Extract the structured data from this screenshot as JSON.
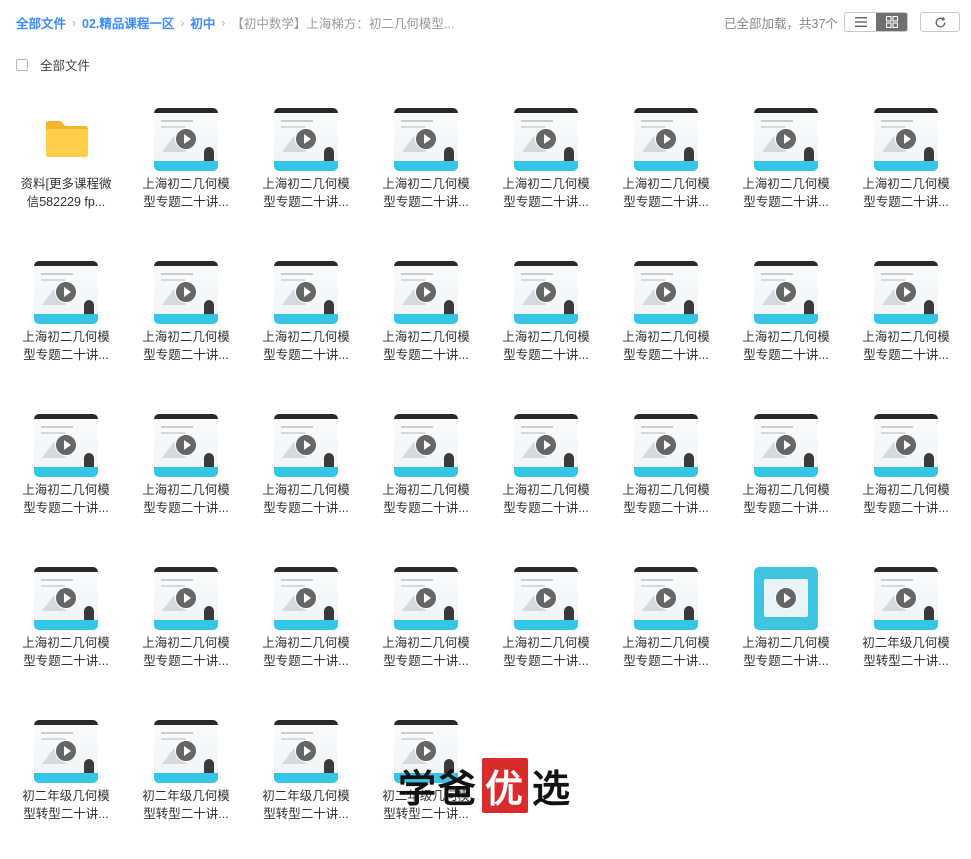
{
  "breadcrumb": {
    "items": [
      "全部文件",
      "02.精品课程一区",
      "初中"
    ],
    "current": "【初中数学】上海梯方：初二几何模型..."
  },
  "header": {
    "status": "已全部加载，共37个"
  },
  "toolbar": {
    "list_view_icon": "list-icon",
    "grid_view_icon": "grid-icon",
    "refresh_icon": "refresh-icon",
    "active_view": "grid"
  },
  "select_all": {
    "label": "全部文件",
    "checked": false
  },
  "files": [
    {
      "type": "folder",
      "name_line1": "资料[更多课程微",
      "name_line2": "信582229 fp..."
    },
    {
      "type": "video",
      "name_line1": "上海初二几何模",
      "name_line2": "型专题二十讲..."
    },
    {
      "type": "video",
      "name_line1": "上海初二几何模",
      "name_line2": "型专题二十讲..."
    },
    {
      "type": "video",
      "name_line1": "上海初二几何模",
      "name_line2": "型专题二十讲..."
    },
    {
      "type": "video",
      "name_line1": "上海初二几何模",
      "name_line2": "型专题二十讲..."
    },
    {
      "type": "video",
      "name_line1": "上海初二几何模",
      "name_line2": "型专题二十讲..."
    },
    {
      "type": "video",
      "name_line1": "上海初二几何模",
      "name_line2": "型专题二十讲..."
    },
    {
      "type": "video",
      "name_line1": "上海初二几何模",
      "name_line2": "型专题二十讲..."
    },
    {
      "type": "video",
      "name_line1": "上海初二几何模",
      "name_line2": "型专题二十讲..."
    },
    {
      "type": "video",
      "name_line1": "上海初二几何模",
      "name_line2": "型专题二十讲..."
    },
    {
      "type": "video",
      "name_line1": "上海初二几何模",
      "name_line2": "型专题二十讲..."
    },
    {
      "type": "video",
      "name_line1": "上海初二几何模",
      "name_line2": "型专题二十讲..."
    },
    {
      "type": "video",
      "name_line1": "上海初二几何模",
      "name_line2": "型专题二十讲..."
    },
    {
      "type": "video",
      "name_line1": "上海初二几何模",
      "name_line2": "型专题二十讲..."
    },
    {
      "type": "video",
      "name_line1": "上海初二几何模",
      "name_line2": "型专题二十讲..."
    },
    {
      "type": "video",
      "name_line1": "上海初二几何模",
      "name_line2": "型专题二十讲..."
    },
    {
      "type": "video",
      "name_line1": "上海初二几何模",
      "name_line2": "型专题二十讲..."
    },
    {
      "type": "video",
      "name_line1": "上海初二几何模",
      "name_line2": "型专题二十讲..."
    },
    {
      "type": "video",
      "name_line1": "上海初二几何模",
      "name_line2": "型专题二十讲..."
    },
    {
      "type": "video",
      "name_line1": "上海初二几何模",
      "name_line2": "型专题二十讲..."
    },
    {
      "type": "video",
      "name_line1": "上海初二几何模",
      "name_line2": "型专题二十讲..."
    },
    {
      "type": "video",
      "name_line1": "上海初二几何模",
      "name_line2": "型专题二十讲..."
    },
    {
      "type": "video",
      "name_line1": "上海初二几何模",
      "name_line2": "型专题二十讲..."
    },
    {
      "type": "video",
      "name_line1": "上海初二几何模",
      "name_line2": "型专题二十讲..."
    },
    {
      "type": "video",
      "name_line1": "上海初二几何模",
      "name_line2": "型专题二十讲..."
    },
    {
      "type": "video",
      "name_line1": "上海初二几何模",
      "name_line2": "型专题二十讲..."
    },
    {
      "type": "video",
      "name_line1": "上海初二几何模",
      "name_line2": "型专题二十讲..."
    },
    {
      "type": "video",
      "name_line1": "上海初二几何模",
      "name_line2": "型专题二十讲..."
    },
    {
      "type": "video",
      "name_line1": "上海初二几何模",
      "name_line2": "型专题二十讲..."
    },
    {
      "type": "video",
      "name_line1": "上海初二几何模",
      "name_line2": "型专题二十讲..."
    },
    {
      "type": "video",
      "name_line1": "上海初二几何模",
      "name_line2": "型专题二十讲...",
      "thumb_style": "teal"
    },
    {
      "type": "video",
      "name_line1": "初二年级几何模",
      "name_line2": "型转型二十讲..."
    },
    {
      "type": "video",
      "name_line1": "初二年级几何模",
      "name_line2": "型转型二十讲..."
    },
    {
      "type": "video",
      "name_line1": "初二年级几何模",
      "name_line2": "型转型二十讲..."
    },
    {
      "type": "video",
      "name_line1": "初二年级几何模",
      "name_line2": "型转型二十讲..."
    },
    {
      "type": "video",
      "name_line1": "初二年级几何模",
      "name_line2": "型转型二十讲..."
    }
  ],
  "watermark": {
    "text_before": "学爸",
    "text_red": "优",
    "text_after": "选"
  },
  "colors": {
    "link": "#3b8cff",
    "strip": "#35c6e6",
    "folder": "#f7c23b",
    "watermark_red": "#d92b2b"
  }
}
